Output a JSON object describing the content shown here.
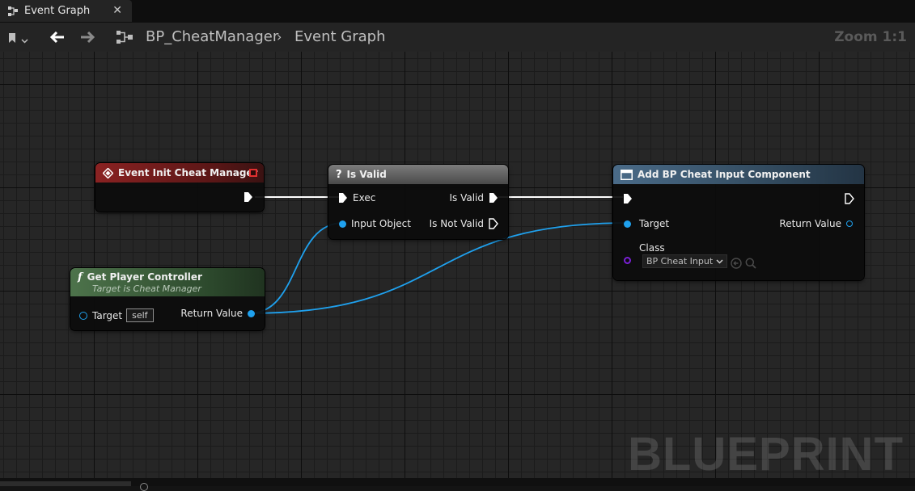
{
  "tab": {
    "title": "Event Graph",
    "close": "✕"
  },
  "breadcrumb": {
    "blueprint": "BP_CheatManager",
    "graph": "Event Graph",
    "separator": "›"
  },
  "zoom_label": "Zoom 1:1",
  "watermark": "BLUEPRINT",
  "colors": {
    "event_header": "#7a1e1e",
    "pure_header": "#3c5e3c",
    "macro_header": "#5a5a5a",
    "function_header": "#3f5a72",
    "object_pin": "#1fa1ee",
    "class_pin": "#7a20d6",
    "exec_wire": "#ffffff"
  },
  "nodes": {
    "event_init": {
      "title": "Event Init Cheat Manager",
      "icon": "event-diamond-icon"
    },
    "is_valid": {
      "title": "Is Valid",
      "icon": "question-icon",
      "pins": {
        "exec": "Exec",
        "input_object": "Input Object",
        "is_valid": "Is Valid",
        "is_not_valid": "Is Not Valid"
      }
    },
    "get_player_controller": {
      "title": "Get Player Controller",
      "subtitle": "Target is Cheat Manager",
      "icon": "function-icon",
      "pins": {
        "target": "Target",
        "target_default": "self",
        "return_value": "Return Value"
      }
    },
    "add_component": {
      "title": "Add BP Cheat Input Component",
      "icon": "component-icon",
      "pins": {
        "target": "Target",
        "return_value": "Return Value",
        "class": "Class",
        "class_value": "BP Cheat Input"
      }
    }
  }
}
